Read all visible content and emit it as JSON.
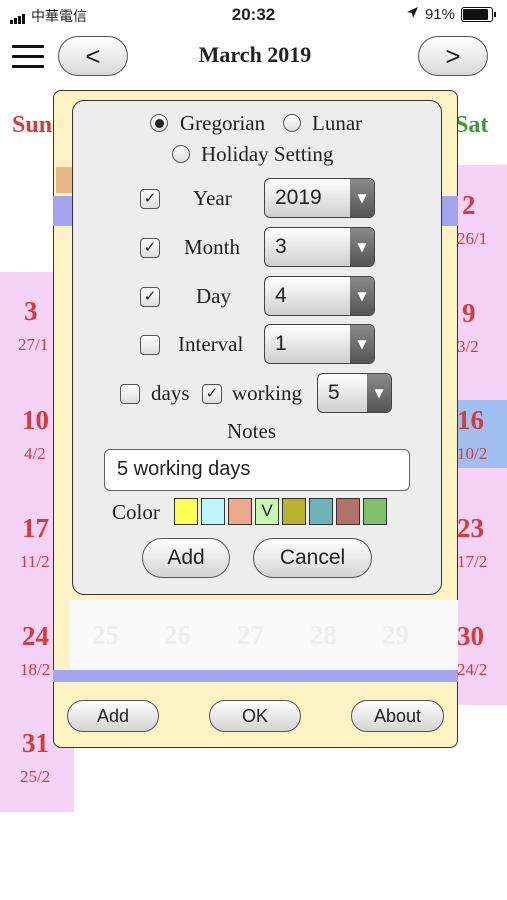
{
  "status_bar": {
    "carrier": "中華電信",
    "time": "20:32",
    "battery": "91%",
    "battery_level": 0.91
  },
  "header": {
    "prev_label": "<",
    "next_label": ">",
    "title": "March 2019"
  },
  "calendar": {
    "sun_label": "Sun",
    "sat_label": "Sat",
    "sunday_dates": [
      {
        "day": "3",
        "lunar": "27/1"
      },
      {
        "day": "10",
        "lunar": "4/2"
      },
      {
        "day": "17",
        "lunar": "11/2"
      },
      {
        "day": "24",
        "lunar": "18/2"
      },
      {
        "day": "31",
        "lunar": "25/2"
      }
    ],
    "saturday_dates": [
      {
        "day": "2",
        "lunar": "26/1"
      },
      {
        "day": "9",
        "lunar": "3/2"
      },
      {
        "day": "16",
        "lunar": "10/2"
      },
      {
        "day": "23",
        "lunar": "17/2"
      },
      {
        "day": "30",
        "lunar": "24/2"
      }
    ],
    "ghost_dates": [
      "25",
      "26",
      "27",
      "28",
      "29"
    ]
  },
  "outer_dialog": {
    "add_label": "Add",
    "ok_label": "OK",
    "about_label": "About"
  },
  "dialog": {
    "calendar_types": [
      {
        "label": "Gregorian",
        "selected": true
      },
      {
        "label": "Lunar",
        "selected": false
      }
    ],
    "holiday_setting_label": "Holiday Setting",
    "year": {
      "label": "Year",
      "checked": true,
      "value": "2019"
    },
    "month": {
      "label": "Month",
      "checked": true,
      "value": "3"
    },
    "day": {
      "label": "Day",
      "checked": true,
      "value": "4"
    },
    "interval": {
      "label": "Interval",
      "checked": false,
      "value": "1"
    },
    "days_label": "days",
    "days_checked": false,
    "working_label": "working",
    "working_checked": true,
    "working_value": "5",
    "notes_label": "Notes",
    "notes_value": "5 working days",
    "color_label": "Color",
    "colors": [
      "#ffff55",
      "#bdf7fb",
      "#f0a88a",
      "#c8f7b0",
      "#b9b32e",
      "#6fb1b6",
      "#b17367",
      "#7fbf6e"
    ],
    "selected_color_mark": "V",
    "add_label": "Add",
    "cancel_label": "Cancel"
  },
  "colors": {
    "sunday": "#d73a3a",
    "saturday": "#3a9a3a",
    "highlight": "#9ebff0"
  }
}
